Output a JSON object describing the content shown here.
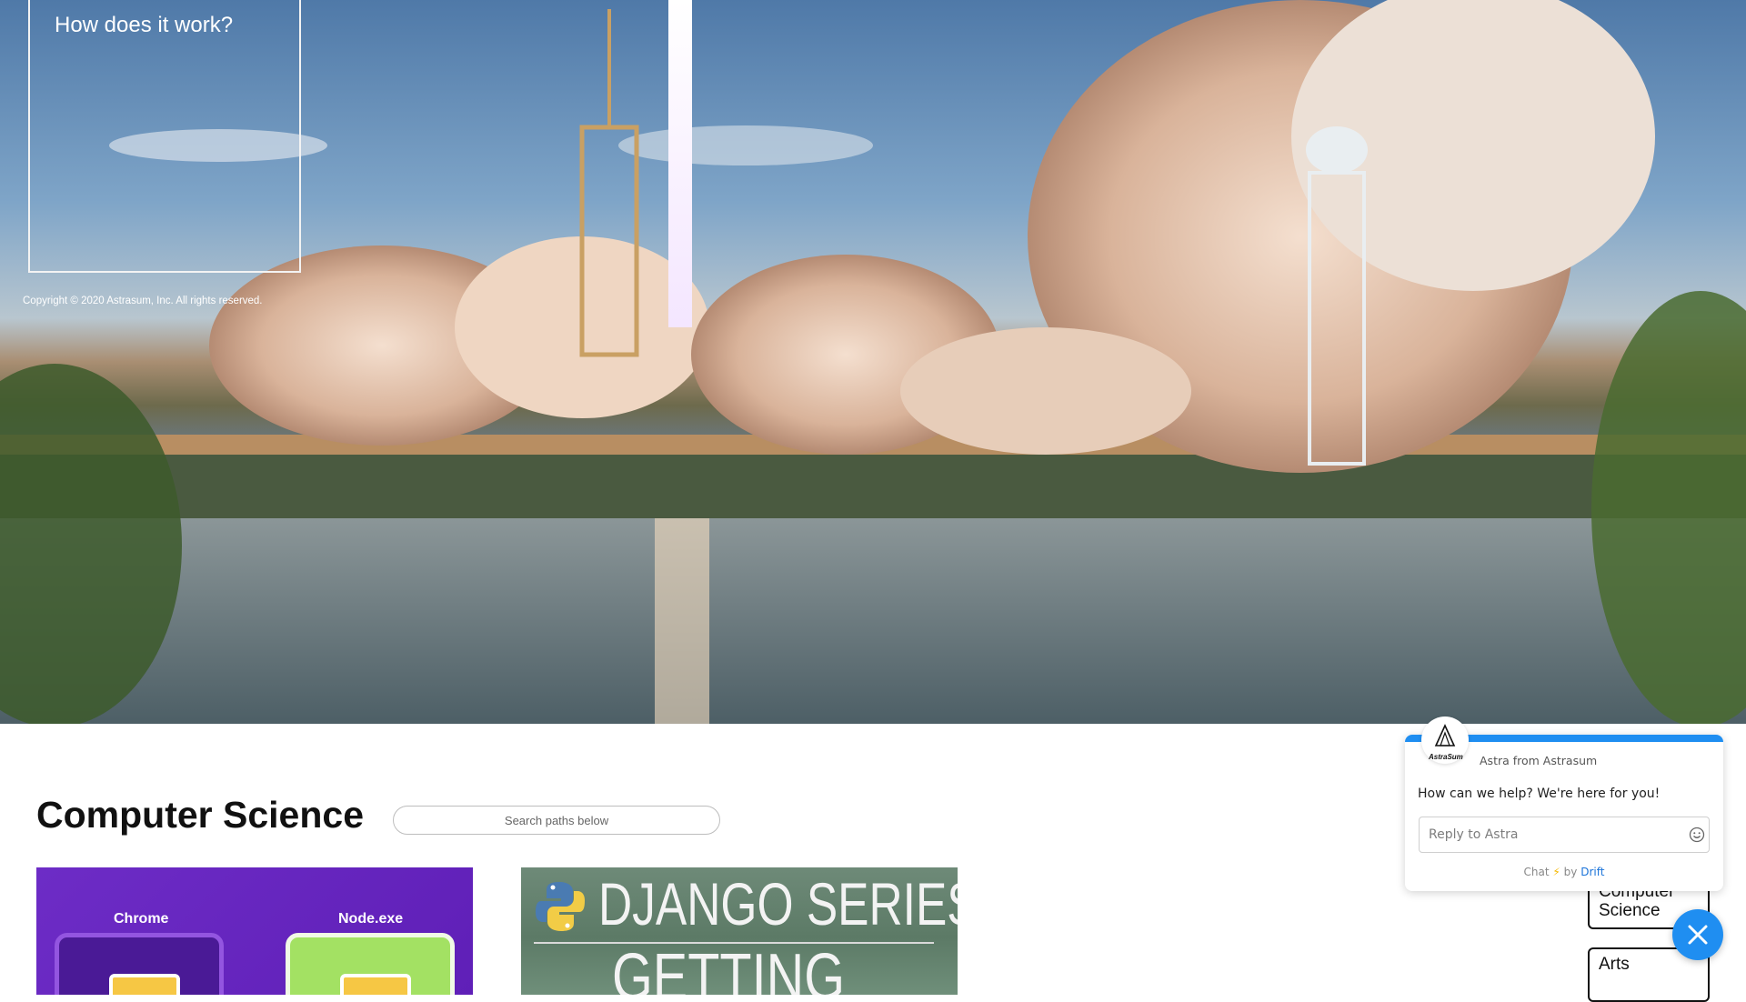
{
  "hero": {
    "info_box_title": "How does it work?",
    "copyright": "Copyright © 2020 Astrasum, Inc. All rights reserved."
  },
  "section": {
    "title": "Computer Science",
    "search_placeholder": "Search paths below"
  },
  "cards": [
    {
      "labels": [
        "Chrome",
        "Node.exe"
      ]
    },
    {
      "title": "DJANGO SERIES",
      "subtitle": "GETTING"
    }
  ],
  "categories": [
    "Computer Science",
    "Arts"
  ],
  "chat": {
    "brand": "AstraSum",
    "from": "Astra from Astrasum",
    "message": "How can we help? We're here for you!",
    "input_placeholder": "Reply to Astra",
    "footer_prefix": "Chat",
    "footer_by": "by",
    "footer_brand": "Drift",
    "accent_color": "#1f8ef1"
  },
  "icons": [
    "avatar-logo-icon",
    "emoji-icon",
    "bolt-icon",
    "close-icon",
    "python-logo-icon"
  ]
}
